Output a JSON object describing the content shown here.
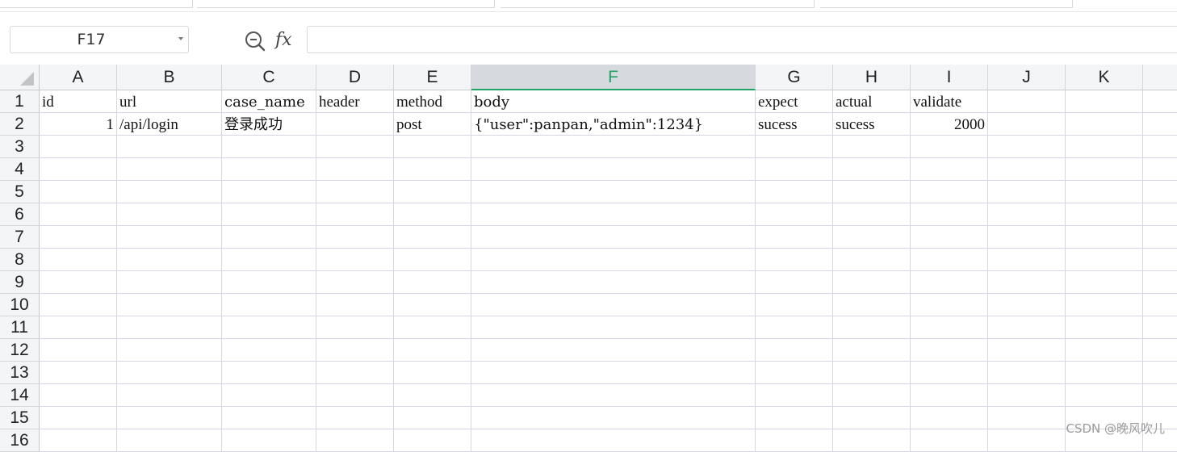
{
  "formula_bar": {
    "name_box": "F17",
    "fx_label": "fx",
    "formula": ""
  },
  "columns": [
    "A",
    "B",
    "C",
    "D",
    "E",
    "F",
    "G",
    "H",
    "I",
    "J",
    "K"
  ],
  "selected_column": "F",
  "rows": [
    "1",
    "2",
    "3",
    "4",
    "5",
    "6",
    "7",
    "8",
    "9",
    "10",
    "11",
    "12",
    "13",
    "14",
    "15",
    "16"
  ],
  "cells": {
    "r1": [
      "id",
      "url",
      "case_name",
      "header",
      "method",
      "body",
      "expect",
      "actual",
      "validate",
      "",
      ""
    ],
    "r2": [
      "1",
      "/api/login",
      "登录成功",
      "",
      "post",
      "{\"user\":panpan,\"admin\":1234}",
      "sucess",
      "sucess",
      "2000",
      "",
      ""
    ]
  },
  "watermark": "CSDN @晚风吹儿",
  "colors": {
    "selection_accent": "#21a366",
    "header_bg": "#f4f5f7",
    "grid_line": "#d4d7df"
  }
}
